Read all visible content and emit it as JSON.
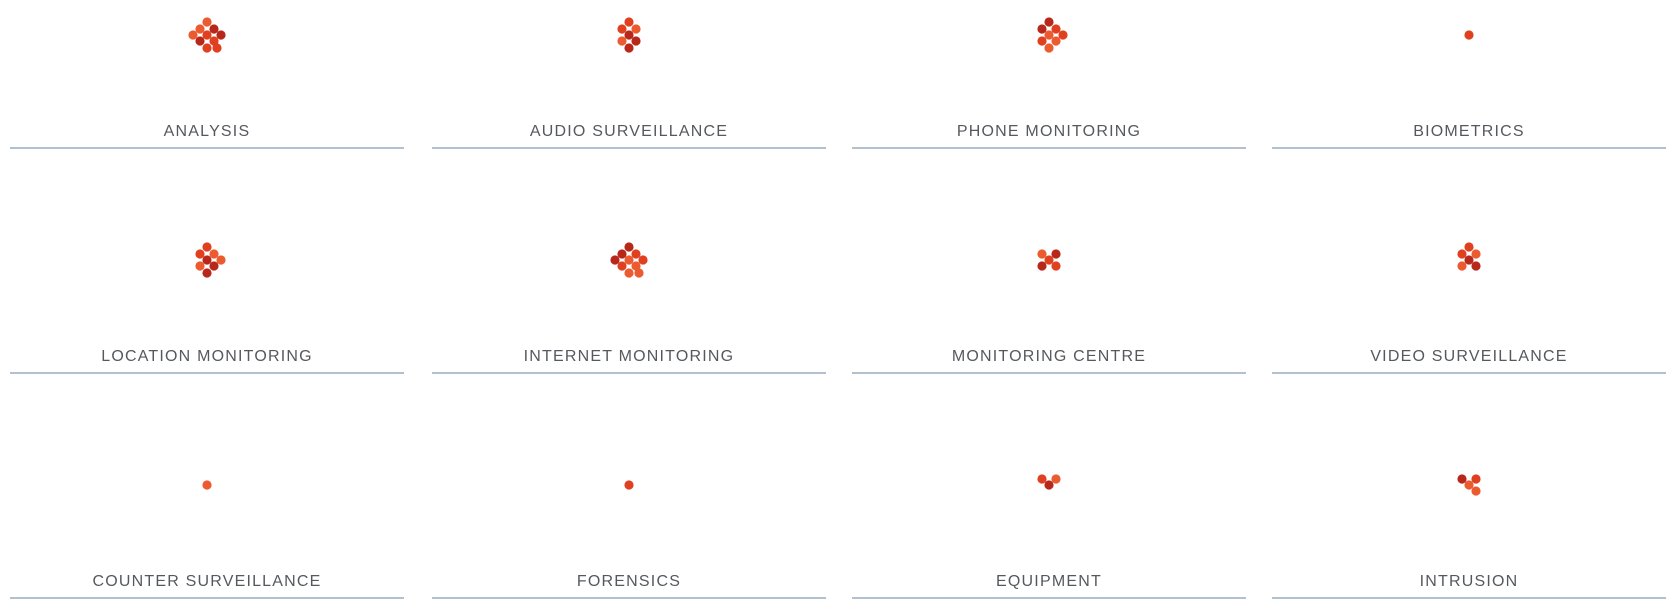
{
  "categories": [
    {
      "id": "analysis",
      "label": "ANALYSIS",
      "dot_count": 10
    },
    {
      "id": "audio-surveillance",
      "label": "AUDIO SURVEILLANCE",
      "dot_count": 7
    },
    {
      "id": "phone-monitoring",
      "label": "PHONE MONITORING",
      "dot_count": 8
    },
    {
      "id": "biometrics",
      "label": "BIOMETRICS",
      "dot_count": 1
    },
    {
      "id": "location-monitoring",
      "label": "LOCATION MONITORING",
      "dot_count": 8
    },
    {
      "id": "internet-monitoring",
      "label": "INTERNET MONITORING",
      "dot_count": 10
    },
    {
      "id": "monitoring-centre",
      "label": "MONITORING CENTRE",
      "dot_count": 5
    },
    {
      "id": "video-surveillance",
      "label": "VIDEO SURVEILLANCE",
      "dot_count": 6
    },
    {
      "id": "counter-surveillance",
      "label": "COUNTER SURVEILLANCE",
      "dot_count": 1
    },
    {
      "id": "forensics",
      "label": "FORENSICS",
      "dot_count": 1
    },
    {
      "id": "equipment",
      "label": "EQUIPMENT",
      "dot_count": 3
    },
    {
      "id": "intrusion",
      "label": "INTRUSION",
      "dot_count": 4
    }
  ],
  "colors": {
    "dot_primary": "#e0401f",
    "dot_dark": "#b8281a",
    "dot_light": "#ec5a30",
    "label_text": "#55595e",
    "divider": "#b3c1cf",
    "background": "#ffffff"
  }
}
